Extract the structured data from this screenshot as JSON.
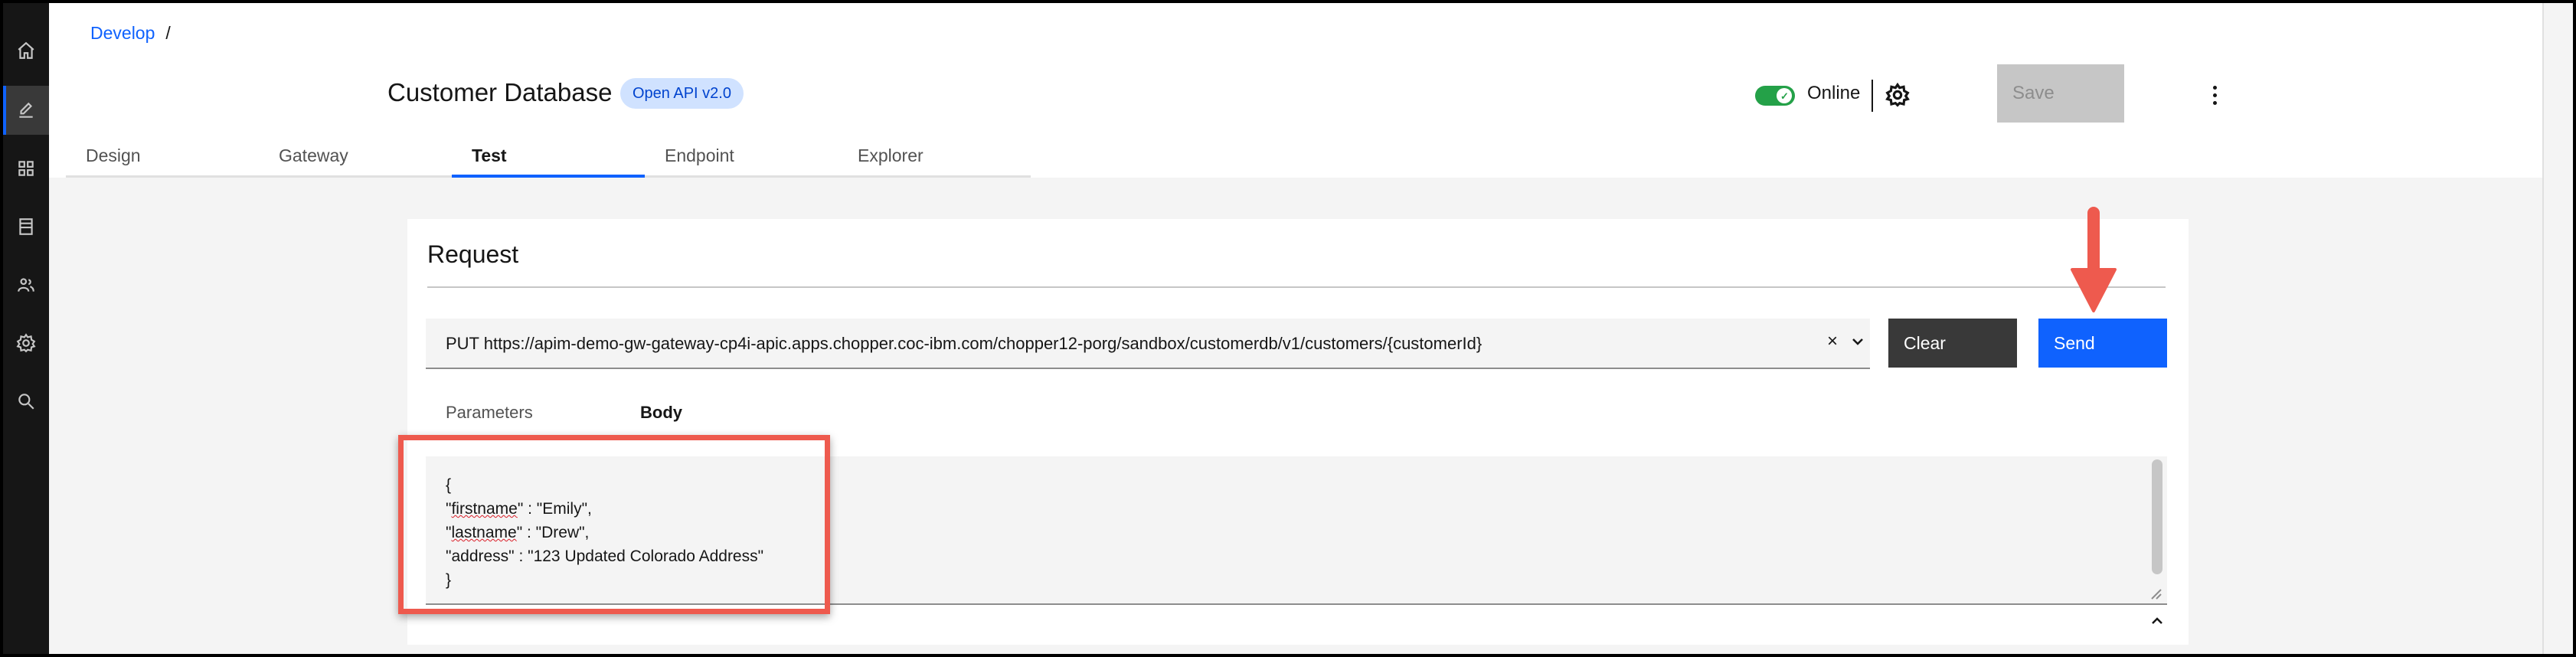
{
  "breadcrumb": {
    "link": "Develop",
    "separator": "/"
  },
  "api": {
    "title": "Customer Database",
    "badge": "Open API v2.0"
  },
  "status": {
    "online_label": "Online",
    "online": true
  },
  "header_actions": {
    "save_label": "Save"
  },
  "tabs": [
    {
      "label": "Design",
      "active": false
    },
    {
      "label": "Gateway",
      "active": false
    },
    {
      "label": "Test",
      "active": true
    },
    {
      "label": "Endpoint",
      "active": false
    },
    {
      "label": "Explorer",
      "active": false
    }
  ],
  "request": {
    "title": "Request",
    "url": "PUT https://apim-demo-gw-gateway-cp4i-apic.apps.chopper.coc-ibm.com/chopper12-porg/sandbox/customerdb/v1/customers/{customerId}",
    "clear_symbol": "×",
    "clear_label": "Clear",
    "send_label": "Send",
    "subtabs": {
      "parameters": "Parameters",
      "body": "Body"
    },
    "body_lines": {
      "open": "{",
      "firstname_pre": "\"",
      "firstname_key": "firstname",
      "firstname_post": "\" : \"Emily\",",
      "lastname_pre": "\"",
      "lastname_key": "lastname",
      "lastname_post": "\" : \"Drew\",",
      "address": "\"address\" : \"123 Updated Colorado Address\"",
      "close": "}"
    }
  },
  "colors": {
    "primary": "#0f62fe",
    "success": "#24a148",
    "annotation": "#ee5a4e"
  },
  "icons": {
    "rail": [
      "home-icon",
      "edit-icon",
      "apps-icon",
      "catalog-icon",
      "users-icon",
      "settings-icon",
      "search-icon"
    ]
  }
}
